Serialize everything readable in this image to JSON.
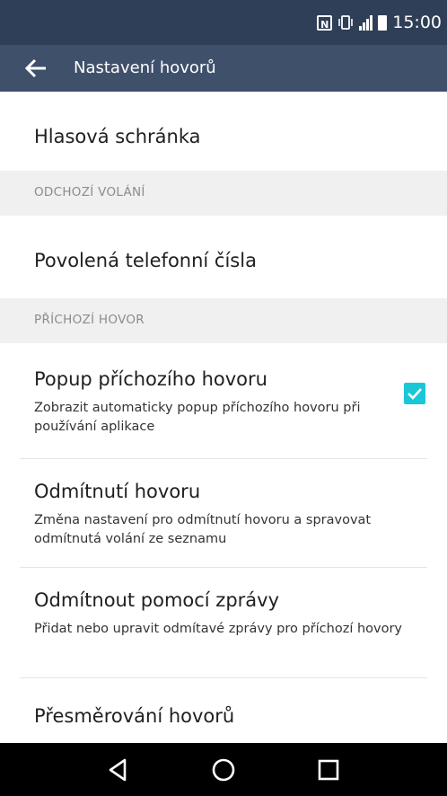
{
  "status_bar": {
    "time": "15:00",
    "nfc_label": "N",
    "icons": [
      "nfc-icon",
      "vibrate-icon",
      "signal-icon",
      "battery-icon"
    ]
  },
  "toolbar": {
    "title": "Nastavení hovorů",
    "back_icon": "arrow-left-icon"
  },
  "settings": {
    "ghost_text": "",
    "voicemail": {
      "title": "Hlasová schránka"
    },
    "section_outgoing": "ODCHOZÍ VOLÁNÍ",
    "fixed_dialing": {
      "title": "Povolená telefonní čísla"
    },
    "section_incoming": "PŘÍCHOZÍ HOVOR",
    "incoming_popup": {
      "title": "Popup příchozího hovoru",
      "subtitle": "Zobrazit automaticky popup příchozího hovoru při používání aplikace",
      "checked": true
    },
    "call_reject": {
      "title": "Odmítnutí hovoru",
      "subtitle": "Změna nastavení pro odmítnutí hovoru a spravovat odmítnutá volání ze seznamu"
    },
    "reject_with_message": {
      "title": "Odmítnout pomocí zprávy",
      "subtitle": "Přidat nebo upravit odmítavé zprávy pro příchozí hovory"
    },
    "call_forwarding": {
      "title": "Přesměrování hovorů"
    }
  },
  "nav_bar": {
    "buttons": [
      "back-triangle-icon",
      "home-circle-icon",
      "recents-square-icon"
    ]
  },
  "colors": {
    "status_bar": "#2f3f57",
    "toolbar": "#3f506b",
    "accent": "#19c7d9",
    "section_bg": "#f0f0f0"
  }
}
